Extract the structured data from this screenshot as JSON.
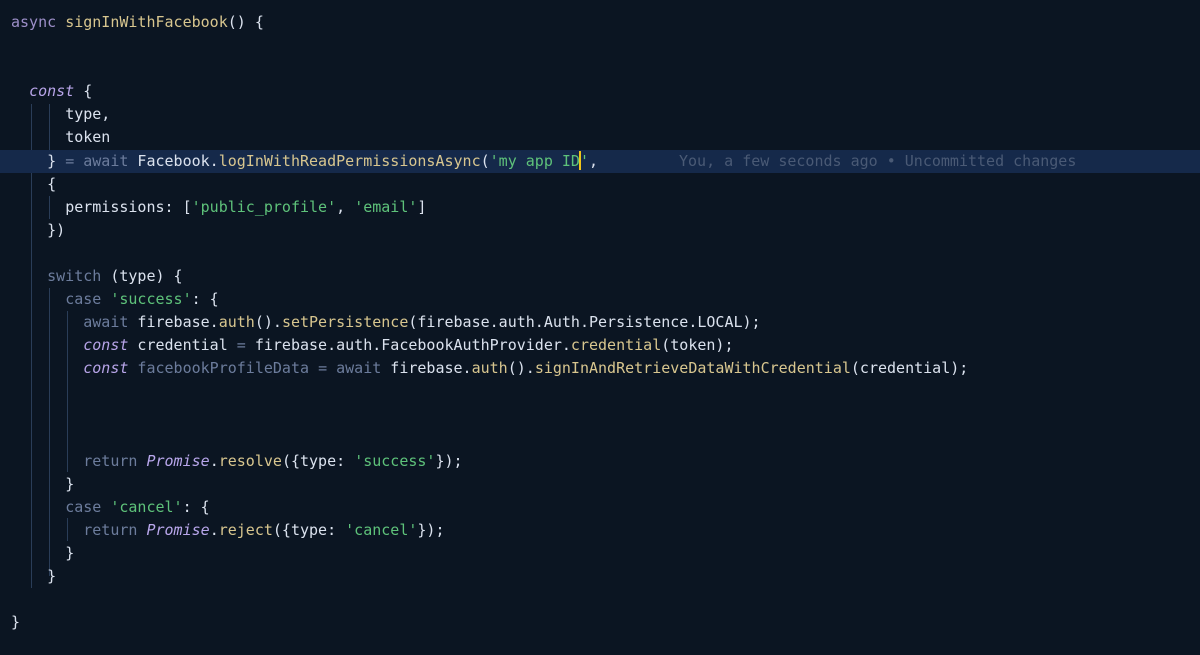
{
  "editor": {
    "blame_annotation": "You, a few seconds ago • Uncommitted changes",
    "lines": {
      "l1": {
        "async": "async",
        "name": "signInWithFacebook",
        "rest": "() {"
      },
      "l4": {
        "const": "const",
        "rest": " {"
      },
      "l5": {
        "text": "type,"
      },
      "l6": {
        "text": "token"
      },
      "l7": {
        "brace": "} ",
        "eq": "= ",
        "await": "await",
        "obj": " Facebook.",
        "fn": "logInWithReadPermissionsAsync",
        "paren": "(",
        "str_before_cursor": "'my app ID",
        "str_after_cursor": "'",
        "comma": ","
      },
      "l8": {
        "text": "{"
      },
      "l9": {
        "prop": "permissions: [",
        "s1": "'public_profile'",
        "sep": ", ",
        "s2": "'email'",
        "end": "]"
      },
      "l10": {
        "text": "})"
      },
      "l12": {
        "switch": "switch",
        "rest": " (type) {"
      },
      "l13": {
        "case": "case",
        "sp": " ",
        "str": "'success'",
        "rest": ": {"
      },
      "l14": {
        "await": "await",
        "p1": " firebase.",
        "fn1": "auth",
        "p2": "().",
        "fn2": "setPersistence",
        "p3": "(firebase.auth.Auth.Persistence.LOCAL);"
      },
      "l15": {
        "const": "const",
        "p1": " credential ",
        "eq": "=",
        "p2": " firebase.auth.FacebookAuthProvider.",
        "fn": "credential",
        "p3": "(token);"
      },
      "l16": {
        "const": "const",
        "p1": " facebookProfileData ",
        "eq": "=",
        "sp": " ",
        "await": "await",
        "p2": " firebase.",
        "fn1": "auth",
        "p3": "().",
        "fn2": "signInAndRetrieveDataWithCredential",
        "p4": "(credential);"
      },
      "l20": {
        "ret": "return",
        "sp": " ",
        "cls": "Promise",
        "dot": ".",
        "fn": "resolve",
        "p1": "({type: ",
        "str": "'success'",
        "p2": "});"
      },
      "l21": {
        "text": "}"
      },
      "l22": {
        "case": "case",
        "sp": " ",
        "str": "'cancel'",
        "rest": ": {"
      },
      "l23": {
        "ret": "return",
        "sp": " ",
        "cls": "Promise",
        "dot": ".",
        "fn": "reject",
        "p1": "({type: ",
        "str": "'cancel'",
        "p2": "});"
      },
      "l24": {
        "text": "}"
      },
      "l25": {
        "text": "}"
      },
      "l27": {
        "text": "}"
      }
    }
  }
}
